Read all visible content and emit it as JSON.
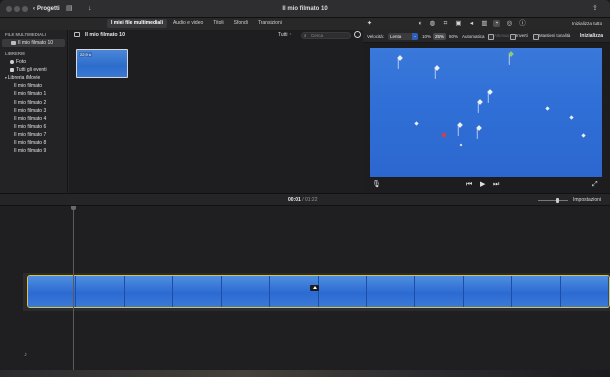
{
  "window": {
    "title": "Il mio filmato 10",
    "back_label": "Progetti"
  },
  "media_tabs": [
    "I miei file multimediali",
    "Audio e video",
    "Titoli",
    "Sfondi",
    "Transizioni"
  ],
  "viewer_toolbar": {
    "reset_all_label": "Inizializza tutto",
    "icons": [
      "magic-wand-icon",
      "color-balance-icon",
      "color-correction-icon",
      "crop-icon",
      "stabilization-icon",
      "volume-icon",
      "noise-reduction-icon",
      "speed-icon",
      "filter-icon",
      "info-icon"
    ],
    "selected_icon": "speed-icon"
  },
  "sidebar": {
    "section_media": "FILE MULTIMEDIALI",
    "project_item": "Il mio filmato 10",
    "section_libraries": "LIBRERIE",
    "libraries": [
      {
        "label": "Foto",
        "icon": "photos-icon"
      },
      {
        "label": "Tutti gli eventi",
        "icon": "events-icon"
      }
    ],
    "library_group": "Libreria iMovie",
    "movies": [
      "Il mio filmato",
      "Il mio filmato 1",
      "Il mio filmato 2",
      "Il mio filmato 3",
      "Il mio filmato 4",
      "Il mio filmato 6",
      "Il mio filmato 7",
      "Il mio filmato 8",
      "Il mio filmato 9"
    ]
  },
  "browser": {
    "title": "Il mio filmato 10",
    "filter_label": "Tutti",
    "search_placeholder": "Cerca",
    "clip_duration": "22,9 s"
  },
  "speed_bar": {
    "speed_label": "Velocità:",
    "speed_value": "Lenta",
    "percent_options": [
      "10%",
      "25%",
      "50%"
    ],
    "selected_percent": "25%",
    "auto_label": "Automatica",
    "freeze_label": "Attenua",
    "reverse_label": "Inverti",
    "preserve_pitch_label": "Mantieni tonalità",
    "reset_label": "Inizializza"
  },
  "timeline": {
    "current_time": "00:01",
    "separator": "/",
    "total_time": "01:22",
    "settings_label": "Impostazioni",
    "zoom_level": 0.66,
    "frame_count": 12
  },
  "colors": {
    "accent": "#2d5fb8",
    "clip_border": "#d9c34a",
    "sky": "#2f6fd6"
  }
}
